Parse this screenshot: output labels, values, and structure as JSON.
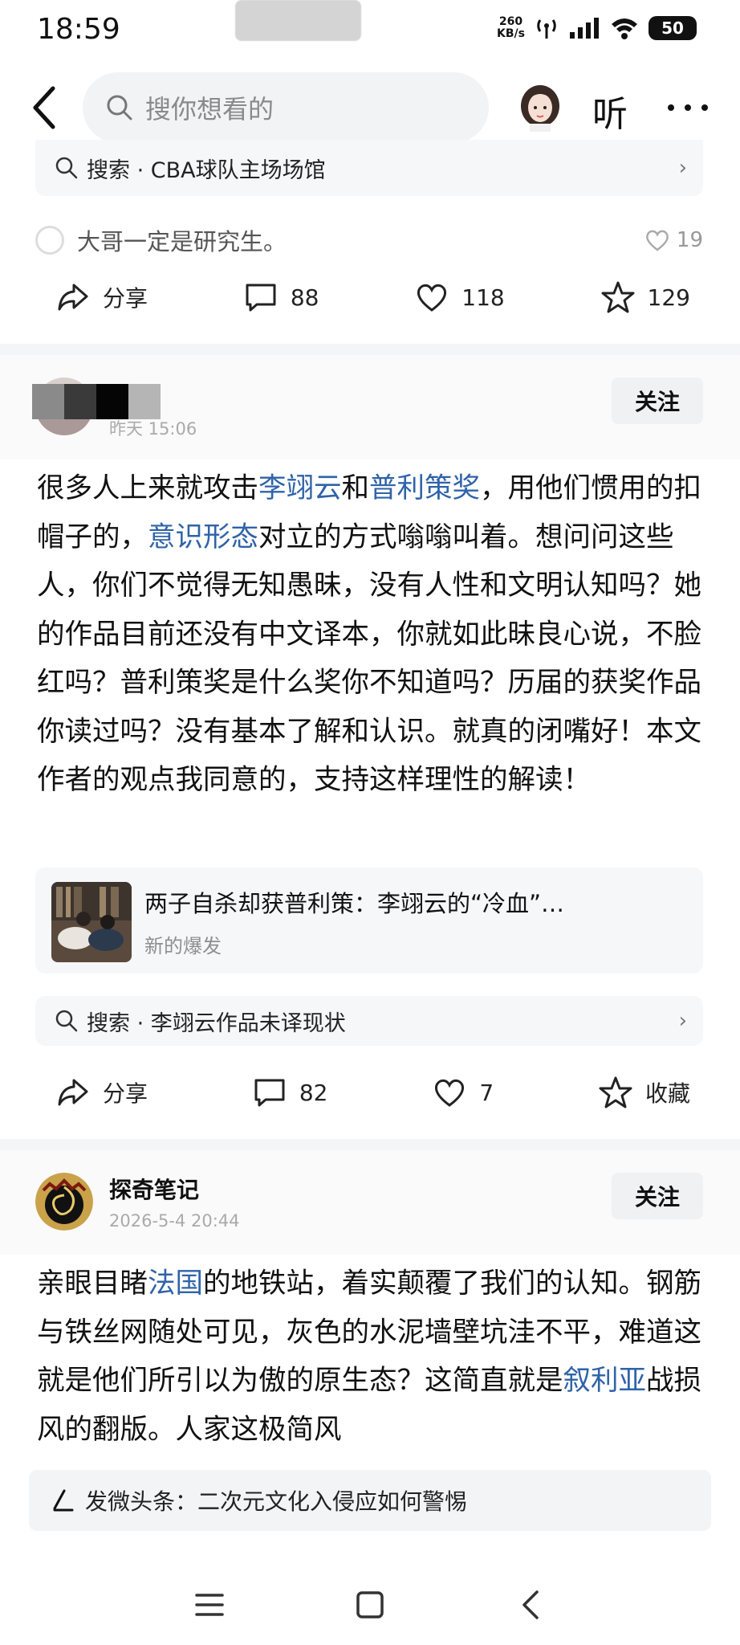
{
  "status_bar": {
    "time": "18:59",
    "net_speed_value": "260",
    "net_speed_unit": "KB/s",
    "battery": "50"
  },
  "top_bar": {
    "search_placeholder": "搜你想看的",
    "listen_label": "听"
  },
  "prev_post": {
    "search_suggestion": "搜索 · CBA球队主场场馆",
    "reply_text": "大哥一定是研究生。",
    "reply_likes": "19",
    "actions": {
      "share": "分享",
      "comments": "88",
      "likes": "118",
      "favorites": "129"
    }
  },
  "post1": {
    "time": "昨天 15:06",
    "follow_label": "关注",
    "body": [
      {
        "text": "很多人上来就攻击"
      },
      {
        "text": "李翊云",
        "link": true
      },
      {
        "text": "和"
      },
      {
        "text": "普利策奖",
        "link": true
      },
      {
        "text": "，用他们惯用的扣帽子的，"
      },
      {
        "text": "意识形态",
        "link": true
      },
      {
        "text": "对立的方式嗡嗡叫着。想问问这些人，你们不觉得无知愚昧，没有人性和文明认知吗？她的作品目前还没有中文译本，你就如此昧良心说，不脸红吗？普利策奖是什么奖你不知道吗？历届的获奖作品你读过吗？没有基本了解和认识。就真的闭嘴好！本文作者的观点我同意的，支持这样理性的解读！"
      }
    ],
    "article": {
      "title": "两子自杀却获普利策：李翊云的“冷血”…",
      "source": "新的爆发"
    },
    "search_suggestion": "搜索 · 李翊云作品未译现状",
    "actions": {
      "share": "分享",
      "comments": "82",
      "likes": "7",
      "favorite": "收藏"
    }
  },
  "post2": {
    "author": "探奇笔记",
    "time": "2026-5-4 20:44",
    "follow_label": "关注",
    "body": [
      {
        "text": "亲眼目睹"
      },
      {
        "text": "法国",
        "link": true
      },
      {
        "text": "的地铁站，着实颠覆了我们的认知。钢筋与铁丝网随处可见，灰色的水泥墙壁坑洼不平，难道这就是他们所引以为傲的原生态？这简直就是"
      },
      {
        "text": "叙利亚",
        "link": true
      },
      {
        "text": "战损风的翻版。人家这极简风"
      }
    ]
  },
  "composer": {
    "text": "发微头条：二次元文化入侵应如何警惕"
  },
  "colors": {
    "link": "#2f63a8",
    "divider": "#f4f5f7",
    "chip_bg": "#f6f7f9"
  }
}
